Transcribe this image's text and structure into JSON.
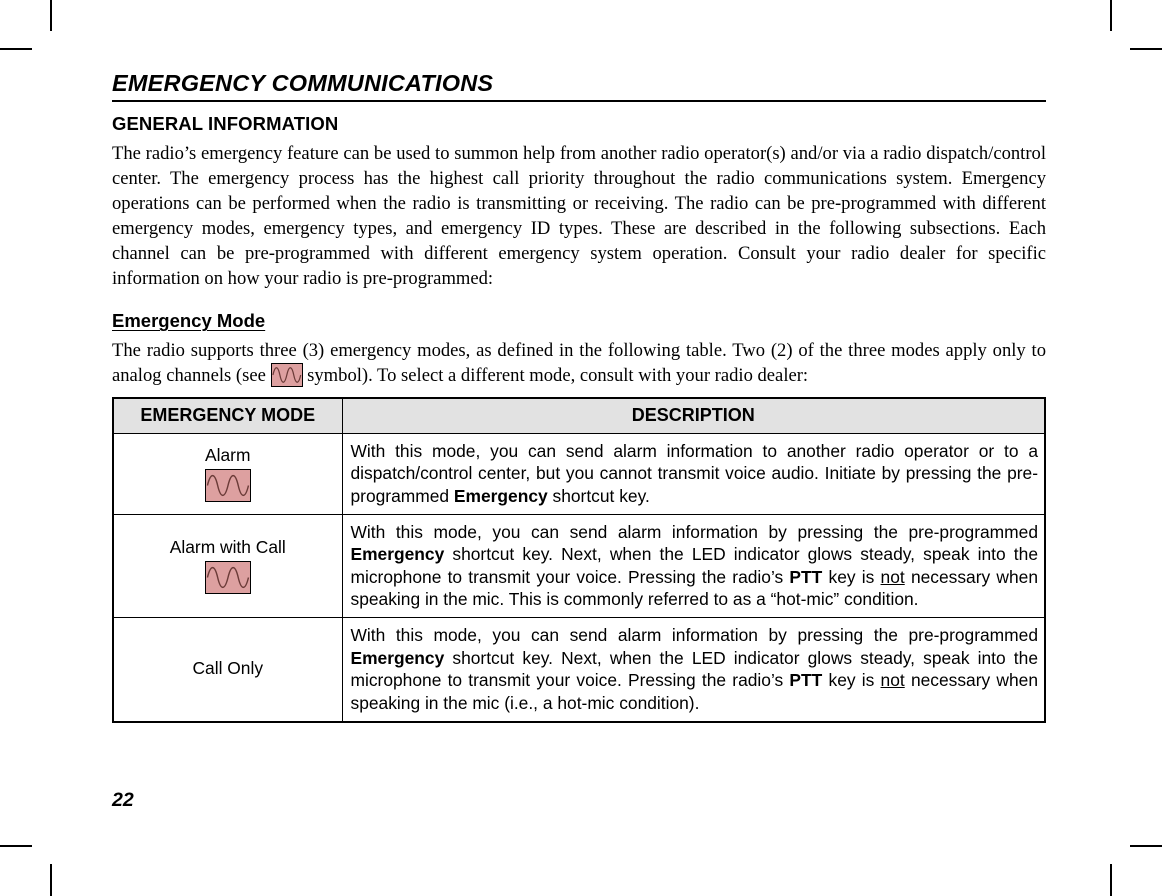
{
  "document": {
    "chapter_title": "EMERGENCY COMMUNICATIONS",
    "page_number": "22"
  },
  "sections": {
    "general_information": {
      "heading": "GENERAL INFORMATION",
      "paragraph": "The radio’s emergency feature can be used to summon help from another radio operator(s) and/or via a radio dispatch/control center. The emergency process has the highest call priority throughout the radio communications system. Emergency operations can be performed when the radio is transmitting or receiving. The radio can be pre-programmed with different emergency modes, emergency types, and emergency ID types. These are described in the following subsections. Each channel can be pre-programmed with different emergency system operation. Consult your radio dealer for specific information on how your radio is pre-programmed:"
    },
    "emergency_mode": {
      "heading": "Emergency Mode",
      "intro_part1": "The radio supports three (3) emergency modes, as defined in the following table. Two (2) of the three modes apply only to analog channels (see ",
      "intro_part2": " symbol). To select a different mode, consult with your radio dealer:"
    }
  },
  "table": {
    "headers": [
      "EMERGENCY MODE",
      "DESCRIPTION"
    ],
    "rows": [
      {
        "mode": "Alarm",
        "has_analog_symbol": true,
        "description_segments": [
          {
            "text": "With this mode, you can send alarm information to another radio operator or to a dispatch/control center, but you cannot transmit voice audio. Initiate by pressing the pre-programmed ",
            "style": "normal"
          },
          {
            "text": "Emergency",
            "style": "bold"
          },
          {
            "text": " shortcut key.",
            "style": "normal"
          }
        ]
      },
      {
        "mode": "Alarm with Call",
        "has_analog_symbol": true,
        "description_segments": [
          {
            "text": "With this mode, you can send alarm information by pressing the pre-programmed ",
            "style": "normal"
          },
          {
            "text": "Emergency",
            "style": "bold"
          },
          {
            "text": " shortcut key. Next, when the LED indicator glows steady, speak into the microphone to transmit your voice. Pressing the radio’s ",
            "style": "normal"
          },
          {
            "text": "PTT",
            "style": "bold"
          },
          {
            "text": " key is ",
            "style": "normal"
          },
          {
            "text": "not",
            "style": "underline"
          },
          {
            "text": " necessary when speaking in the mic. This is commonly referred to as a “hot-mic” condition.",
            "style": "normal"
          }
        ]
      },
      {
        "mode": "Call Only",
        "has_analog_symbol": false,
        "description_segments": [
          {
            "text": "With this mode, you can send alarm information by pressing the pre-programmed ",
            "style": "normal"
          },
          {
            "text": "Emergency",
            "style": "bold"
          },
          {
            "text": " shortcut key. Next, when the LED indicator glows steady, speak into the microphone to transmit your voice. Pressing the radio’s ",
            "style": "normal"
          },
          {
            "text": "PTT",
            "style": "bold"
          },
          {
            "text": " key is ",
            "style": "normal"
          },
          {
            "text": "not",
            "style": "underline"
          },
          {
            "text": " necessary when speaking in the mic (i.e., a hot-mic condition).",
            "style": "normal"
          }
        ]
      }
    ]
  },
  "icons": {
    "analog_channel_symbol": {
      "name": "analog-waveform-icon",
      "fill_color": "#dda0a0",
      "line_color": "#6b3b38",
      "border_color": "#000000"
    }
  },
  "colors": {
    "page_background": "#ffffff",
    "text": "#000000",
    "table_header_background": "#e2e2e2",
    "table_border": "#000000",
    "analog_symbol_fill": "#dda0a0"
  }
}
